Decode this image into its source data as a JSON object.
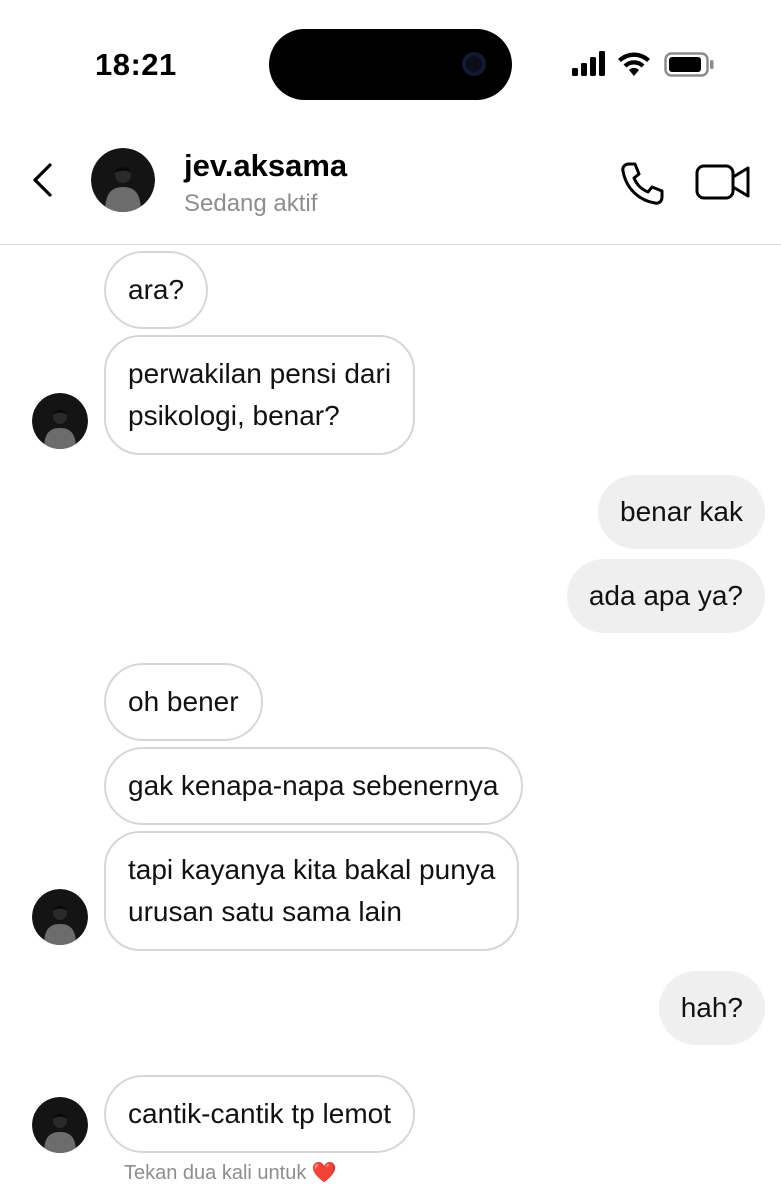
{
  "status_bar": {
    "time": "18:21"
  },
  "header": {
    "username": "jev.aksama",
    "status": "Sedang aktif"
  },
  "messages": [
    {
      "from": "them",
      "text": "ara?"
    },
    {
      "from": "them",
      "text_lines": [
        "perwakilan pensi dari",
        "psikologi, benar?"
      ]
    },
    {
      "from": "me",
      "text": "benar kak"
    },
    {
      "from": "me",
      "text": "ada apa ya?"
    },
    {
      "from": "them",
      "text": "oh bener"
    },
    {
      "from": "them",
      "text": "gak kenapa-napa sebenernya"
    },
    {
      "from": "them",
      "text_lines": [
        "tapi kayanya kita bakal punya",
        "urusan satu sama lain"
      ]
    },
    {
      "from": "me",
      "text": "hah?"
    },
    {
      "from": "them",
      "text": "cantik-cantik tp lemot"
    }
  ],
  "hint": {
    "text": "Tekan dua kali untuk",
    "emoji": "❤️"
  },
  "colors": {
    "incoming_border": "#d6d6d6",
    "outgoing_bg": "#efefef",
    "muted_text": "#8e8e8e"
  },
  "icons": [
    "back-chevron-icon",
    "phone-icon",
    "video-camera-icon",
    "signal-icon",
    "wifi-icon",
    "battery-icon"
  ]
}
